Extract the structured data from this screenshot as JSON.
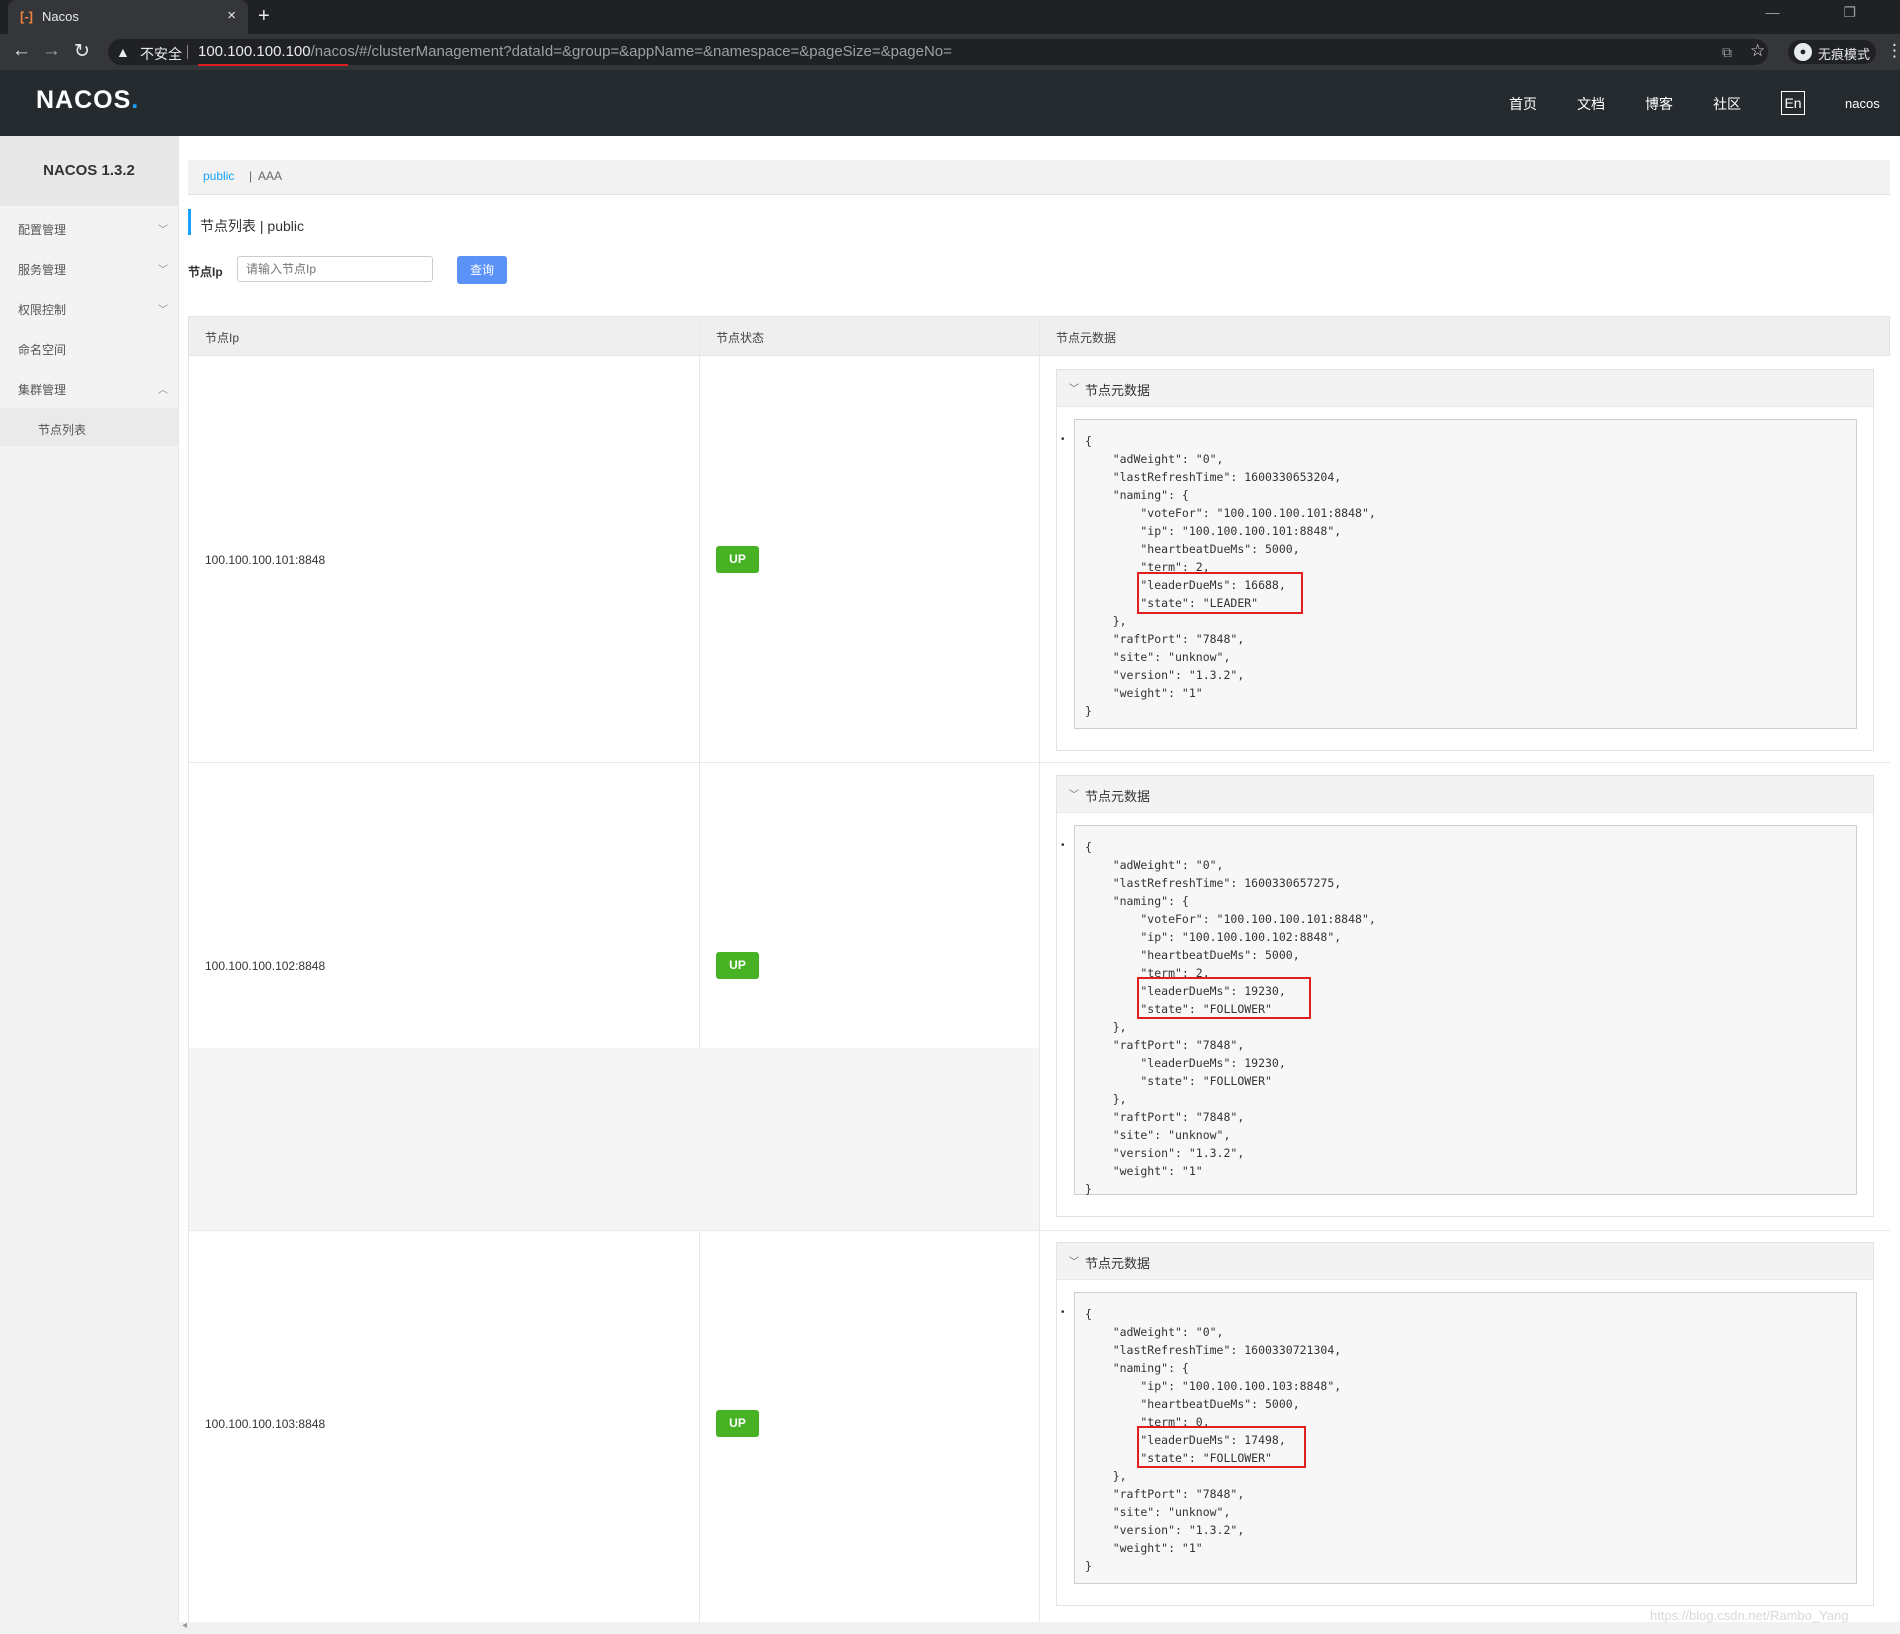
{
  "browser": {
    "tab_title": "Nacos",
    "tab_close": "×",
    "new_tab": "+",
    "window_controls": "— ❐",
    "back": "←",
    "forward": "→",
    "reload": "↻",
    "warning_icon": "▲",
    "insecure_label": "不安全",
    "url_host": "100.100.100.100",
    "url_path": "/nacos/#/clusterManagement?dataId=&group=&appName=&namespace=&pageSize=&pageNo=",
    "translate_icon": "⧉",
    "star_icon": "☆",
    "incognito_icon": "●",
    "incognito_label": "无痕模式",
    "menu_icon": "⋮"
  },
  "header": {
    "logo": "NACOS",
    "logo_dot": ".",
    "nav": [
      "首页",
      "文档",
      "博客",
      "社区"
    ],
    "lang": "En",
    "user": "nacos"
  },
  "sidebar": {
    "version": "NACOS 1.3.2",
    "items": [
      {
        "label": "配置管理",
        "caret": "﹀"
      },
      {
        "label": "服务管理",
        "caret": "﹀"
      },
      {
        "label": "权限控制",
        "caret": "﹀"
      },
      {
        "label": "命名空间",
        "caret": ""
      },
      {
        "label": "集群管理",
        "caret": "︿"
      }
    ],
    "sub_item": "节点列表"
  },
  "breadcrumb": {
    "active": "public",
    "sep": "|",
    "other": "AAA"
  },
  "page_title": "节点列表  |  public",
  "search": {
    "label": "节点Ip",
    "placeholder": "请输入节点Ip",
    "button": "查询"
  },
  "table": {
    "headers": [
      "节点Ip",
      "节点状态",
      "节点元数据"
    ],
    "rows": [
      {
        "ip": "100.100.100.101:8848",
        "state": "UP",
        "panel_title": "节点元数据",
        "metadata": "{\n    \"adWeight\": \"0\",\n    \"lastRefreshTime\": 1600330653204,\n    \"naming\": {\n        \"voteFor\": \"100.100.100.101:8848\",\n        \"ip\": \"100.100.100.101:8848\",\n        \"heartbeatDueMs\": 5000,\n        \"term\": 2,\n        \"leaderDueMs\": 16688,\n        \"state\": \"LEADER\"\n    },\n    \"raftPort\": \"7848\",\n    \"site\": \"unknow\",\n    \"version\": \"1.3.2\",\n    \"weight\": \"1\"\n}"
      },
      {
        "ip": "100.100.100.102:8848",
        "state": "UP",
        "panel_title": "节点元数据",
        "metadata": "{\n    \"adWeight\": \"0\",\n    \"lastRefreshTime\": 1600330657275,\n    \"naming\": {\n        \"voteFor\": \"100.100.100.101:8848\",\n        \"ip\": \"100.100.100.102:8848\",\n        \"heartbeatDueMs\": 5000,\n        \"term\": 2,\n        \"leaderDueMs\": 19230,\n        \"state\": \"FOLLOWER\"\n    },\n    \"raftPort\": \"7848\",\n        \"leaderDueMs\": 19230,\n        \"state\": \"FOLLOWER\"\n    },\n    \"raftPort\": \"7848\",\n    \"site\": \"unknow\",\n    \"version\": \"1.3.2\",\n    \"weight\": \"1\"\n}"
      },
      {
        "ip": "100.100.100.103:8848",
        "state": "UP",
        "panel_title": "节点元数据",
        "metadata": "{\n    \"adWeight\": \"0\",\n    \"lastRefreshTime\": 1600330721304,\n    \"naming\": {\n        \"ip\": \"100.100.100.103:8848\",\n        \"heartbeatDueMs\": 5000,\n        \"term\": 0,\n        \"leaderDueMs\": 17498,\n        \"state\": \"FOLLOWER\"\n    },\n    \"raftPort\": \"7848\",\n    \"site\": \"unknow\",\n    \"version\": \"1.3.2\",\n    \"weight\": \"1\"\n}"
      }
    ],
    "bullet": "•"
  },
  "watermark": "https://blog.csdn.net/Rambo_Yang",
  "scroll_arrow": "◂"
}
